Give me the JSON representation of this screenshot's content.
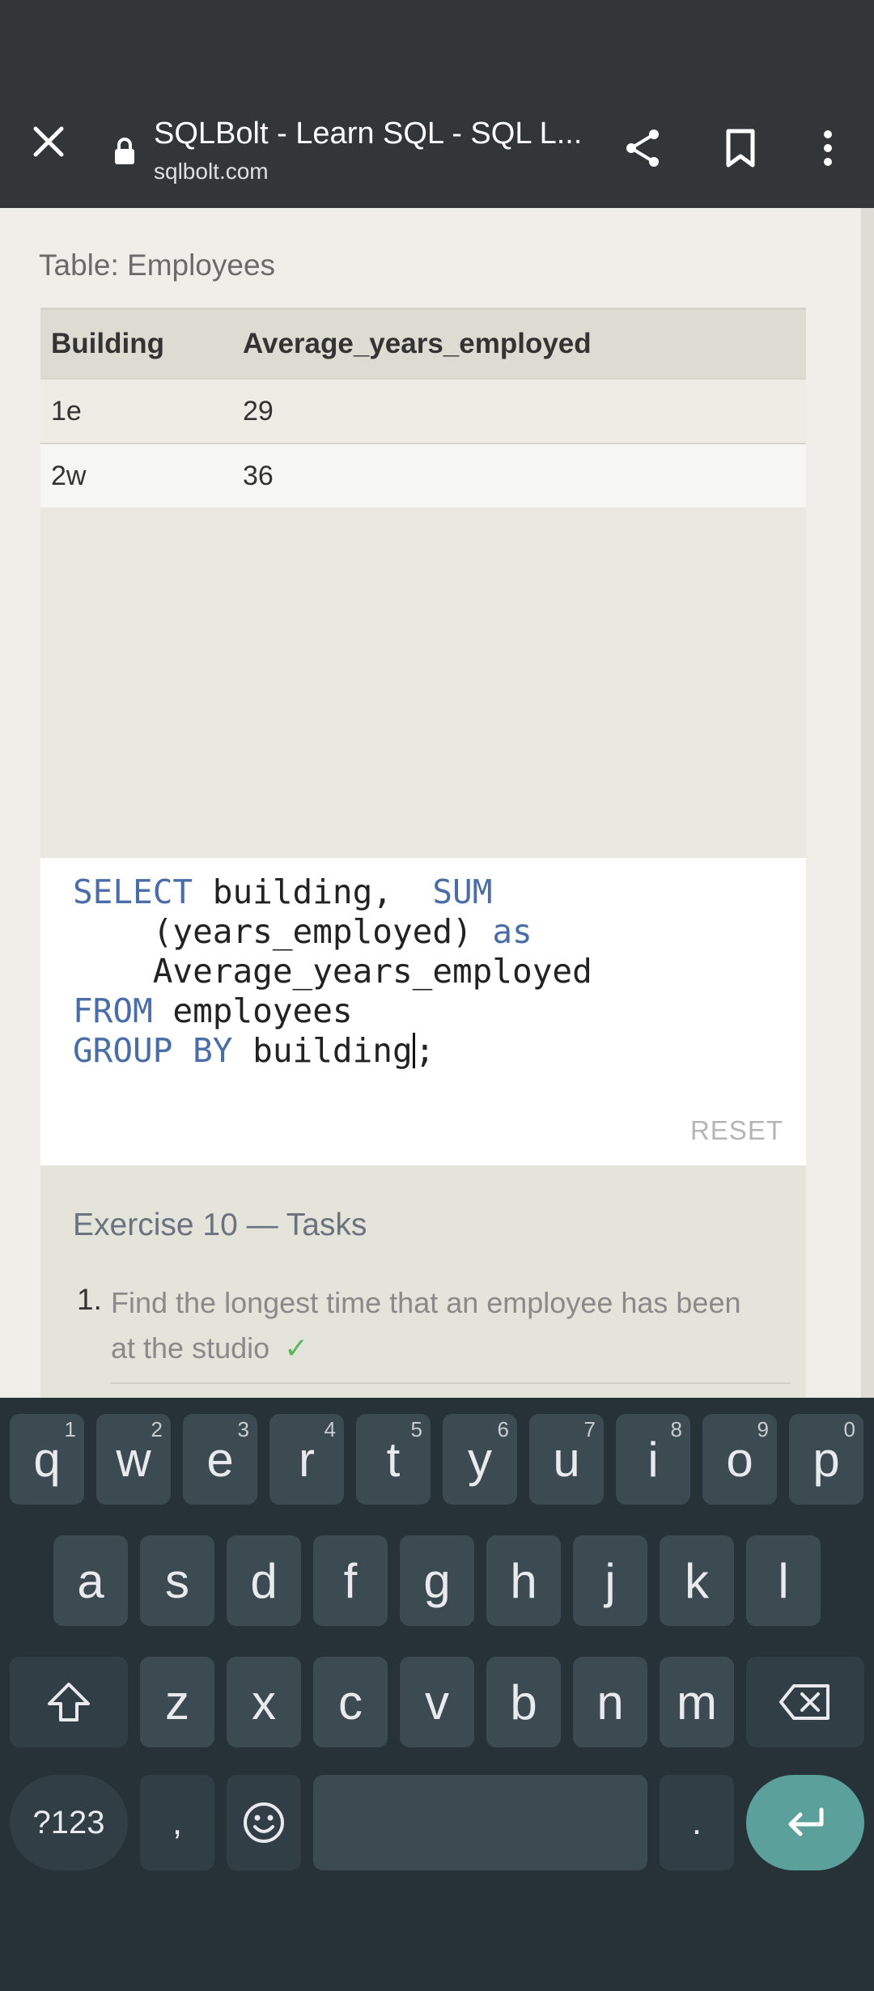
{
  "browser": {
    "title": "SQLBolt - Learn SQL - SQL L...",
    "url": "sqlbolt.com"
  },
  "result": {
    "caption": "Table: Employees",
    "columns": [
      "Building",
      "Average_years_employed"
    ],
    "rows": [
      [
        "1e",
        "29"
      ],
      [
        "2w",
        "36"
      ]
    ]
  },
  "editor": {
    "code": {
      "l1_kw1": "SELECT",
      "l1_txt1": " building,  ",
      "l1_kw2": "SUM",
      "l2_txt": "    (years_employed) ",
      "l2_kw": "as",
      "l3_txt": "    Average_years_employed",
      "l4_kw": "FROM",
      "l4_txt": " employees",
      "l5_kw": "GROUP BY",
      "l5_txt": " building",
      "l5_after": ";"
    },
    "reset_label": "RESET"
  },
  "tasks": {
    "title": "Exercise 10 — Tasks",
    "items": [
      {
        "number": "1.",
        "text": "Find the longest time that an employee has been at the studio",
        "check": "✓"
      }
    ]
  },
  "keyboard": {
    "row1": [
      {
        "key": "q",
        "hint": "1"
      },
      {
        "key": "w",
        "hint": "2"
      },
      {
        "key": "e",
        "hint": "3"
      },
      {
        "key": "r",
        "hint": "4"
      },
      {
        "key": "t",
        "hint": "5"
      },
      {
        "key": "y",
        "hint": "6"
      },
      {
        "key": "u",
        "hint": "7"
      },
      {
        "key": "i",
        "hint": "8"
      },
      {
        "key": "o",
        "hint": "9"
      },
      {
        "key": "p",
        "hint": "0"
      }
    ],
    "row2": [
      "a",
      "s",
      "d",
      "f",
      "g",
      "h",
      "j",
      "k",
      "l"
    ],
    "row3": [
      "z",
      "x",
      "c",
      "v",
      "b",
      "n",
      "m"
    ],
    "symbols_label": "?123",
    "comma": ",",
    "period": "."
  },
  "icons": {
    "close": "close-icon",
    "lock": "lock-icon",
    "share": "share-icon",
    "bookmark": "bookmark-icon",
    "menu": "more-vert-icon",
    "shift": "shift-icon",
    "backspace": "backspace-icon",
    "emoji": "emoji-icon",
    "enter": "enter-icon"
  },
  "colors": {
    "toolbar": "#323639",
    "keyword": "#4a6da8",
    "check": "#5cb85c",
    "enter_key": "#5ba09b"
  }
}
